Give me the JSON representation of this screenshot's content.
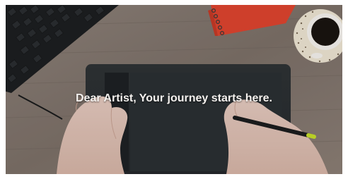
{
  "video": {
    "caption": "Dear Artist, Your journey starts here."
  },
  "scene": {
    "objects": [
      "keyboard",
      "red-spiral-notebook",
      "coffee-cup",
      "graphics-tablet",
      "stylus-pen",
      "hands"
    ]
  }
}
